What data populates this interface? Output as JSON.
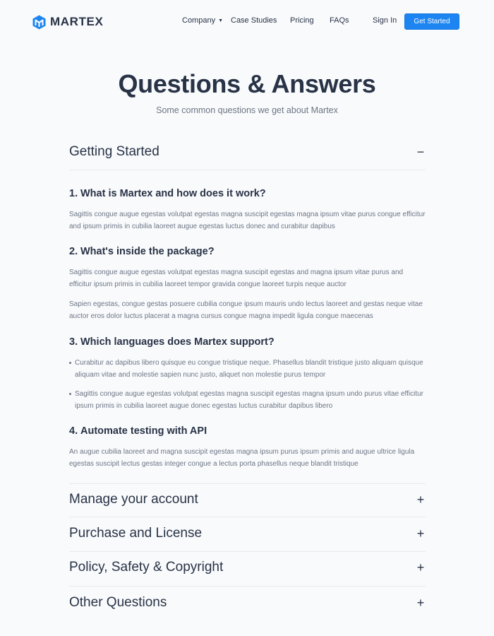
{
  "header": {
    "logo_text": "MARTEX",
    "nav": {
      "company": "Company",
      "case_studies": "Case Studies",
      "pricing": "Pricing",
      "faqs": "FAQs",
      "sign_in": "Sign In"
    },
    "cta": "Get Started"
  },
  "hero": {
    "title": "Questions & Answers",
    "subtitle": "Some common questions we get about Martex"
  },
  "sections": {
    "getting_started": {
      "title": "Getting Started",
      "icon": "minus-icon",
      "questions": [
        {
          "num": "1.",
          "title": "What is Martex and how does it work?",
          "paragraphs": [
            "Sagittis congue augue egestas volutpat egestas magna suscipit egestas magna ipsum vitae purus congue efficitur and ipsum primis in cubilia laoreet augue egestas luctus donec and curabitur dapibus"
          ]
        },
        {
          "num": "2.",
          "title": "What's inside the package?",
          "paragraphs": [
            "Sagittis congue augue egestas volutpat egestas magna suscipit egestas and magna ipsum vitae purus and efficitur ipsum primis in cubilia laoreet tempor gravida congue laoreet turpis neque auctor",
            "Sapien egestas, congue gestas posuere cubilia congue ipsum mauris undo lectus laoreet and gestas neque vitae auctor eros dolor luctus placerat a magna cursus congue magna impedit ligula congue maecenas"
          ]
        },
        {
          "num": "3.",
          "title": "Which languages does Martex support?",
          "bullets": [
            "Curabitur ac dapibus libero quisque eu congue tristique neque. Phasellus blandit tristique justo aliquam quisque aliquam vitae and molestie sapien nunc justo, aliquet non molestie purus tempor",
            "Sagittis congue augue egestas volutpat egestas magna suscipit egestas magna ipsum undo purus vitae efficitur ipsum primis in cubilia laoreet augue donec egestas luctus curabitur dapibus libero"
          ]
        },
        {
          "num": "4.",
          "title": "Automate testing with API",
          "paragraphs": [
            "An augue cubilia laoreet and magna suscipit egestas magna ipsum purus ipsum primis and augue ultrice ligula egestas suscipit lectus gestas integer congue a lectus porta phasellus neque blandit tristique"
          ]
        }
      ]
    },
    "manage_account": {
      "title": "Manage your account",
      "icon": "plus-icon"
    },
    "purchase_license": {
      "title": "Purchase and License",
      "icon": "plus-icon"
    },
    "policy_safety": {
      "title": "Policy, Safety & Copyright",
      "icon": "plus-icon"
    },
    "other_questions": {
      "title": "Other Questions",
      "icon": "plus-icon"
    }
  },
  "colors": {
    "accent": "#1c85f1",
    "text_dark": "#283346",
    "text_muted": "#6c7685",
    "background": "#f9fafc"
  }
}
